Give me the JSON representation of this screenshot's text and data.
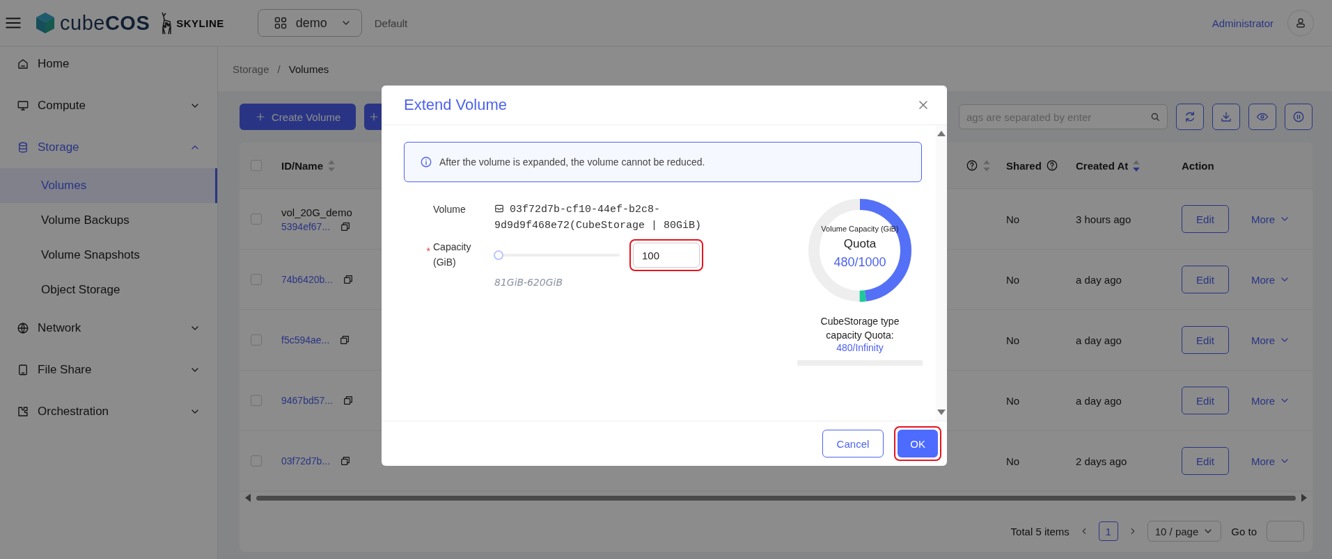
{
  "header": {
    "logo": "cube**COS**",
    "partner_logo": "SKYLINE",
    "project": "demo",
    "domain": "Default",
    "user": "Administrator"
  },
  "sidebar": {
    "items": [
      {
        "label": "Home",
        "kind": "link",
        "selected": false
      },
      {
        "label": "Compute",
        "kind": "group",
        "selected": false,
        "expanded": false
      },
      {
        "label": "Storage",
        "kind": "group",
        "selected": true,
        "expanded": true,
        "children": [
          {
            "label": "Volumes",
            "selected": true
          },
          {
            "label": "Volume Backups",
            "selected": false
          },
          {
            "label": "Volume Snapshots",
            "selected": false
          },
          {
            "label": "Object Storage",
            "selected": false
          }
        ]
      },
      {
        "label": "Network",
        "kind": "group",
        "selected": false,
        "expanded": false
      },
      {
        "label": "File Share",
        "kind": "group",
        "selected": false,
        "expanded": false
      },
      {
        "label": "Orchestration",
        "kind": "group",
        "selected": false,
        "expanded": false
      }
    ]
  },
  "breadcrumb": {
    "items": [
      "Storage",
      "Volumes"
    ],
    "separator": "/"
  },
  "toolbar": {
    "buttons": [
      {
        "kind": "text",
        "label": "Create Volume"
      },
      {
        "kind": "icon"
      }
    ],
    "search": {
      "placeholder": "ags are separated by enter"
    }
  },
  "table": {
    "all_checked": false,
    "columns": [
      {
        "label": "ID/Name",
        "sortable": true,
        "sorted": false,
        "help": false
      },
      {
        "sortable": true,
        "sorted": false,
        "help": true
      },
      {
        "label": "Shared",
        "sortable": false,
        "help": true
      },
      {
        "label": "Created At",
        "sortable": true,
        "sorted": true,
        "help": false
      },
      {
        "label": "Action",
        "sortable": false,
        "help": false
      }
    ],
    "rows": [
      {
        "checked": false,
        "name": "vol_20G_demo",
        "id": "5394ef67...",
        "shared": "No",
        "created": "3 hours ago",
        "actions": [
          "Edit",
          "More"
        ]
      },
      {
        "checked": false,
        "id": "74b6420b...",
        "shared": "No",
        "created": "a day ago",
        "actions": [
          "Edit",
          "More"
        ]
      },
      {
        "checked": false,
        "id": "f5c594ae...",
        "shared": "No",
        "created": "a day ago",
        "actions": [
          "Edit",
          "More"
        ]
      },
      {
        "checked": false,
        "id": "9467bd57...",
        "shared": "No",
        "created": "a day ago",
        "actions": [
          "Edit",
          "More"
        ]
      },
      {
        "checked": false,
        "id": "03f72d7b...",
        "shared": "No",
        "created": "2 days ago",
        "actions": [
          "Edit",
          "More"
        ]
      }
    ]
  },
  "pagination": {
    "total": "Total 5 items",
    "pages": [
      {
        "label": "1",
        "selected": true
      }
    ],
    "page_size": "10 / page",
    "goto": "Go to"
  },
  "dialog": {
    "title": "Extend Volume",
    "alert": "After the volume is expanded, the volume cannot be reduced.",
    "volume": {
      "label": "Volume",
      "value": "03f72d7b-cf10-44ef-b2c8-9d9d9f468e72(CubeStorage | 80GiB)"
    },
    "capacity": {
      "label": "Capacity (GiB)",
      "required_mark": "*",
      "level": 0.035,
      "value": "100",
      "range": "81GiB-620GiB",
      "highlighted": true
    },
    "quota": {
      "title": "Volume Capacity (GiB)",
      "label": "Quota",
      "reading": "480/1000",
      "segments": [
        {
          "color": "#5470f7",
          "level": 0.48
        },
        {
          "color": "#1ec99a",
          "level": 0.02
        }
      ]
    },
    "type_quota": {
      "label": "CubeStorage type capacity Quota:",
      "reading": "480/Infinity",
      "level": 0
    },
    "buttons": [
      {
        "label": "Cancel",
        "kind": "default",
        "highlighted": false
      },
      {
        "label": "OK",
        "kind": "primary",
        "highlighted": true
      }
    ]
  }
}
